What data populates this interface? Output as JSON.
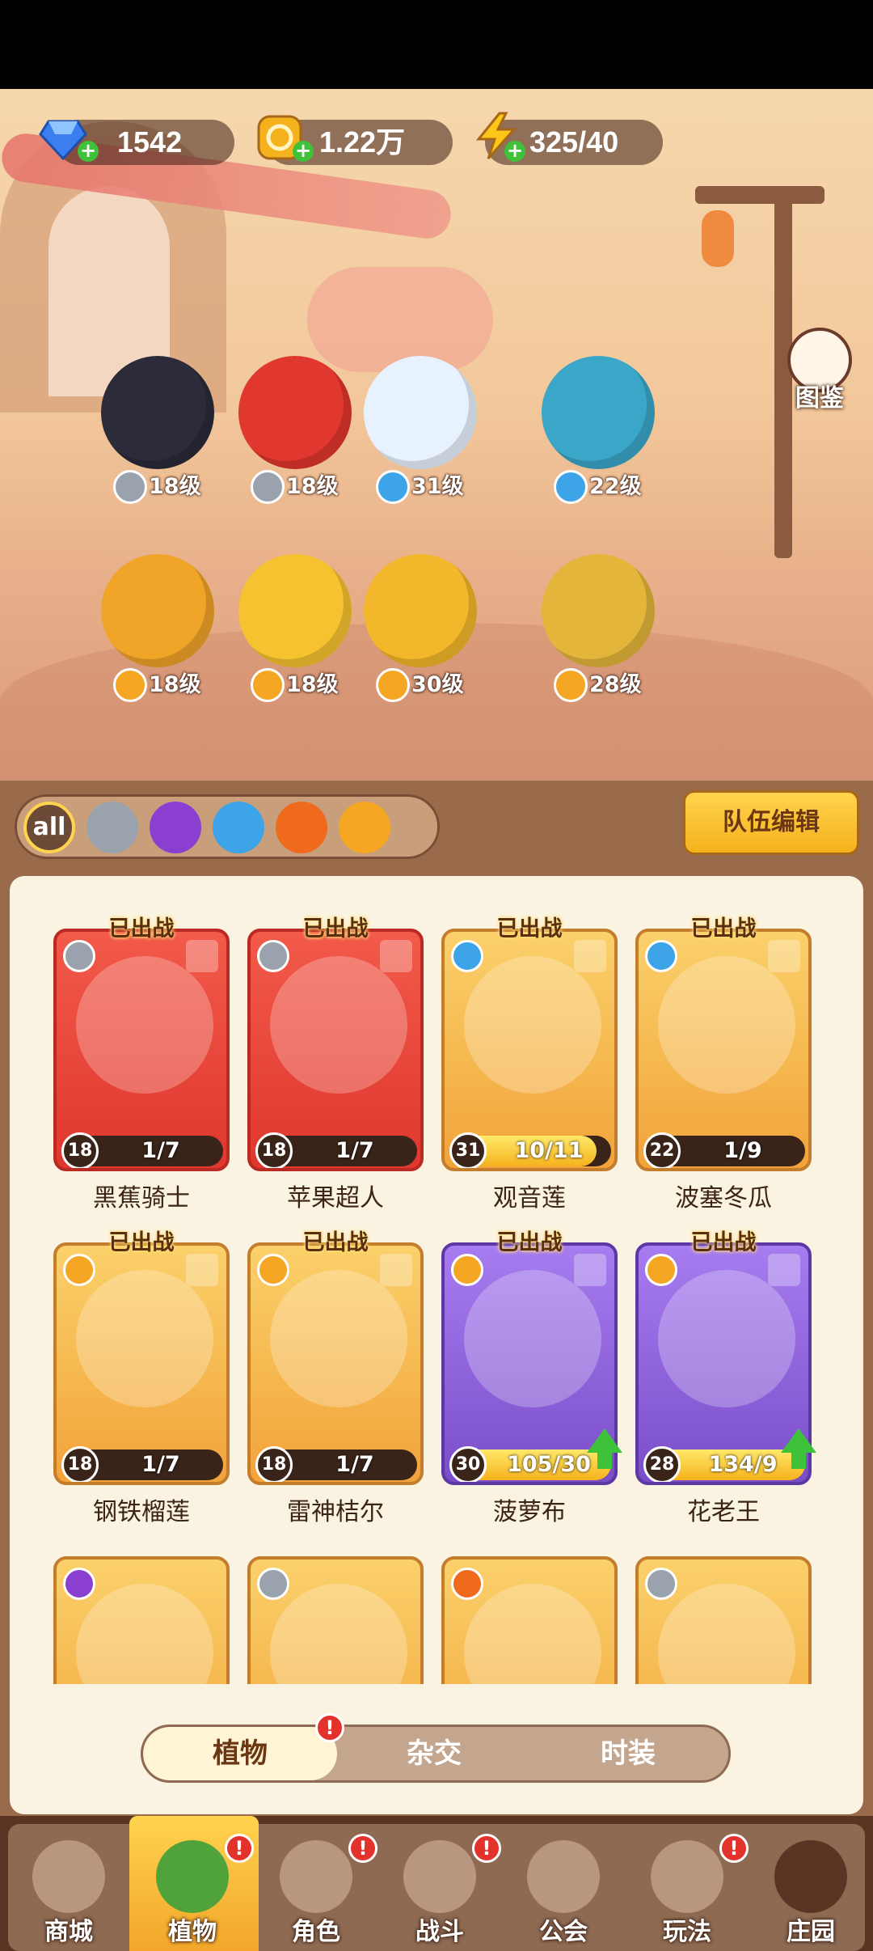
{
  "currencies": {
    "gems": "1542",
    "coins": "1.22万",
    "energy": "325/40"
  },
  "atlas_label": "图鉴",
  "scene_characters": [
    {
      "level": "18级",
      "element": "sword"
    },
    {
      "level": "18级",
      "element": "sword"
    },
    {
      "level": "31级",
      "element": "water"
    },
    {
      "level": "22级",
      "element": "water"
    },
    {
      "level": "18级",
      "element": "lightning"
    },
    {
      "level": "18级",
      "element": "lightning"
    },
    {
      "level": "30级",
      "element": "lightning"
    },
    {
      "level": "28级",
      "element": "lightning"
    }
  ],
  "filters": {
    "all_label": "all",
    "items": [
      "sword",
      "potion",
      "water",
      "fire",
      "lightning"
    ]
  },
  "team_edit_label": "队伍编辑",
  "deployed_label": "已出战",
  "cards": [
    {
      "name": "黑蕉骑士",
      "level": "18",
      "progress": "1/7",
      "fill": 0.14,
      "style": "red",
      "element": "sword"
    },
    {
      "name": "苹果超人",
      "level": "18",
      "progress": "1/7",
      "fill": 0.14,
      "style": "red",
      "element": "sword"
    },
    {
      "name": "观音莲",
      "level": "31",
      "progress": "10/11",
      "fill": 0.91,
      "style": "gold",
      "element": "water"
    },
    {
      "name": "波塞冬瓜",
      "level": "22",
      "progress": "1/9",
      "fill": 0.11,
      "style": "gold",
      "element": "water"
    },
    {
      "name": "钢铁榴莲",
      "level": "18",
      "progress": "1/7",
      "fill": 0.14,
      "style": "gold",
      "element": "lightning"
    },
    {
      "name": "雷神桔尔",
      "level": "18",
      "progress": "1/7",
      "fill": 0.14,
      "style": "gold",
      "element": "lightning"
    },
    {
      "name": "菠萝布",
      "level": "30",
      "progress": "105/30",
      "fill": 1,
      "style": "purple",
      "element": "lightning"
    },
    {
      "name": "花老王",
      "level": "28",
      "progress": "134/9",
      "fill": 1,
      "style": "purple",
      "element": "lightning"
    }
  ],
  "partial_cards": [
    {
      "element": "potion",
      "style": "gold"
    },
    {
      "element": "sword",
      "style": "gold"
    },
    {
      "element": "fire",
      "style": "gold"
    },
    {
      "element": "sword",
      "style": "gold"
    }
  ],
  "category_tabs": [
    "植物",
    "杂交",
    "时装"
  ],
  "alert_mark": "!",
  "nav": [
    "商城",
    "植物",
    "角色",
    "战斗",
    "公会",
    "玩法",
    "庄园"
  ],
  "colors": {
    "water": "#3da4e8",
    "lightning": "#f5a623",
    "fire": "#f06a1e",
    "sword": "#9aa3ad",
    "potion": "#8a3fd1",
    "alert": "#e3312b"
  }
}
